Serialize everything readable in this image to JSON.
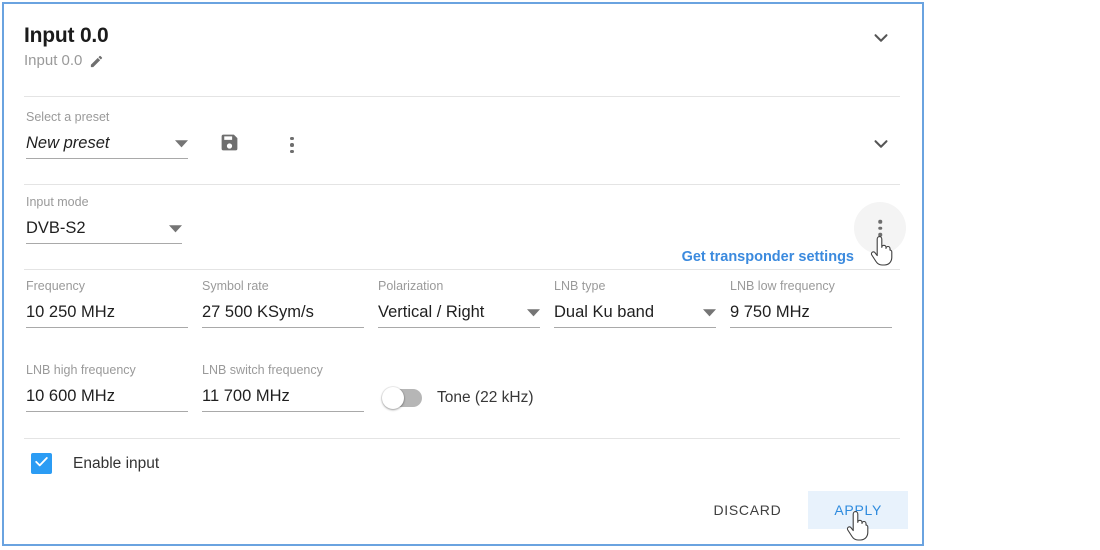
{
  "panel": {
    "border_color": "#6aa3e0",
    "accent_color": "#3b8ade",
    "checkbox_color": "#2b9cf4"
  },
  "header": {
    "title": "Input 0.0",
    "subtitle": "Input 0.0",
    "edit_icon": "pencil-icon",
    "collapse_icon": "chevron-down-icon"
  },
  "preset": {
    "label": "Select a preset",
    "value": "New preset",
    "dropdown_icon": "caret-down-icon",
    "save_icon": "floppy-save-icon",
    "more_icon": "kebab-menu-icon",
    "collapse_icon": "chevron-down-icon"
  },
  "input_mode": {
    "label": "Input mode",
    "value": "DVB-S2",
    "dropdown_icon": "caret-down-icon"
  },
  "transponder": {
    "link_label": "Get transponder settings",
    "more_icon": "kebab-menu-icon"
  },
  "fields": {
    "frequency": {
      "label": "Frequency",
      "value": "10 250 MHz"
    },
    "symbol_rate": {
      "label": "Symbol rate",
      "value": "27 500 KSym/s"
    },
    "polarization": {
      "label": "Polarization",
      "value": "Vertical / Right"
    },
    "lnb_type": {
      "label": "LNB type",
      "value": "Dual Ku band"
    },
    "lnb_low_frequency": {
      "label": "LNB low frequency",
      "value": "9 750 MHz"
    },
    "lnb_high_frequency": {
      "label": "LNB high frequency",
      "value": "10 600 MHz"
    },
    "lnb_switch_frequency": {
      "label": "LNB switch frequency",
      "value": "11 700 MHz"
    }
  },
  "tone": {
    "label": "Tone (22 kHz)",
    "state": "off"
  },
  "enable_input": {
    "label": "Enable input",
    "checked": "true",
    "check_icon": "checkmark-icon"
  },
  "actions": {
    "discard_label": "DISCARD",
    "apply_label": "APPLY"
  },
  "cursors": {
    "pointer_icon": "hand-pointer-cursor"
  }
}
